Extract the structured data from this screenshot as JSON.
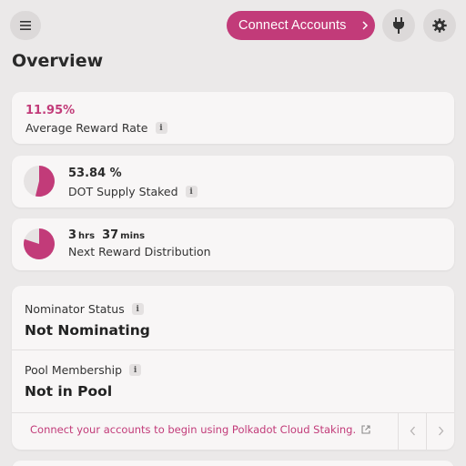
{
  "header": {
    "connect_label": "Connect Accounts",
    "accent": "#c23b79"
  },
  "page": {
    "title": "Overview"
  },
  "stats": {
    "reward_rate": {
      "value": "11.95%",
      "label": "Average Reward Rate"
    },
    "supply_staked": {
      "value": "53.84 %",
      "label": "DOT Supply Staked",
      "percent": 53.84
    },
    "next_distribution": {
      "hours": "3",
      "hours_unit": "hrs",
      "minutes": "37",
      "minutes_unit": "mins",
      "label": "Next Reward Distribution",
      "fraction_elapsed": 0.8
    }
  },
  "status": {
    "nominator_label": "Nominator Status",
    "nominator_value": "Not Nominating",
    "pool_label": "Pool Membership",
    "pool_value": "Not in Pool",
    "footer_note": "Connect your accounts to begin using Polkadot Cloud Staking."
  },
  "icons": {
    "menu": "hamburger-icon",
    "plug": "plug-icon",
    "gear": "gear-icon",
    "info": "info-icon",
    "external": "external-link-icon"
  }
}
